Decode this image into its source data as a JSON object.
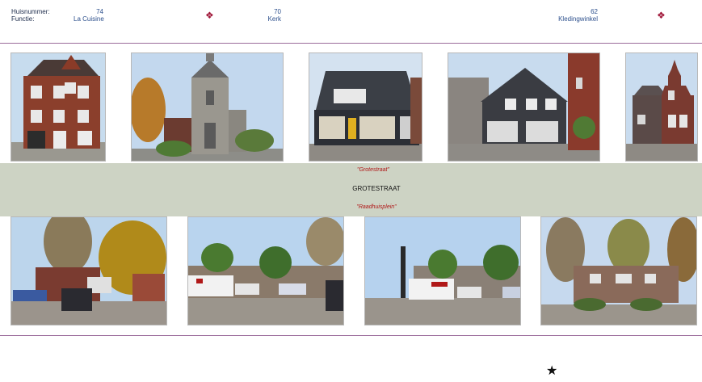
{
  "header": {
    "huisnummer_label": "Huisnummer:",
    "functie_label": "Functie:",
    "entries": [
      {
        "number": "74",
        "function": "La Cuisine"
      },
      {
        "number": "70",
        "function": "Kerk"
      },
      {
        "number": "62",
        "function": "Kledingwinkel"
      }
    ],
    "diamond_glyph": "❖"
  },
  "band": {
    "top_quote": "\"Grotestraat\"",
    "street_name": "GROTESTRAAT",
    "bottom_quote": "\"Raadhuisplein\""
  },
  "footer": {
    "star_glyph": "★"
  },
  "colors": {
    "rule": "#9a6b9a",
    "band": "#cdd3c4",
    "accent_red": "#b01818",
    "diamond": "#a0183a"
  }
}
